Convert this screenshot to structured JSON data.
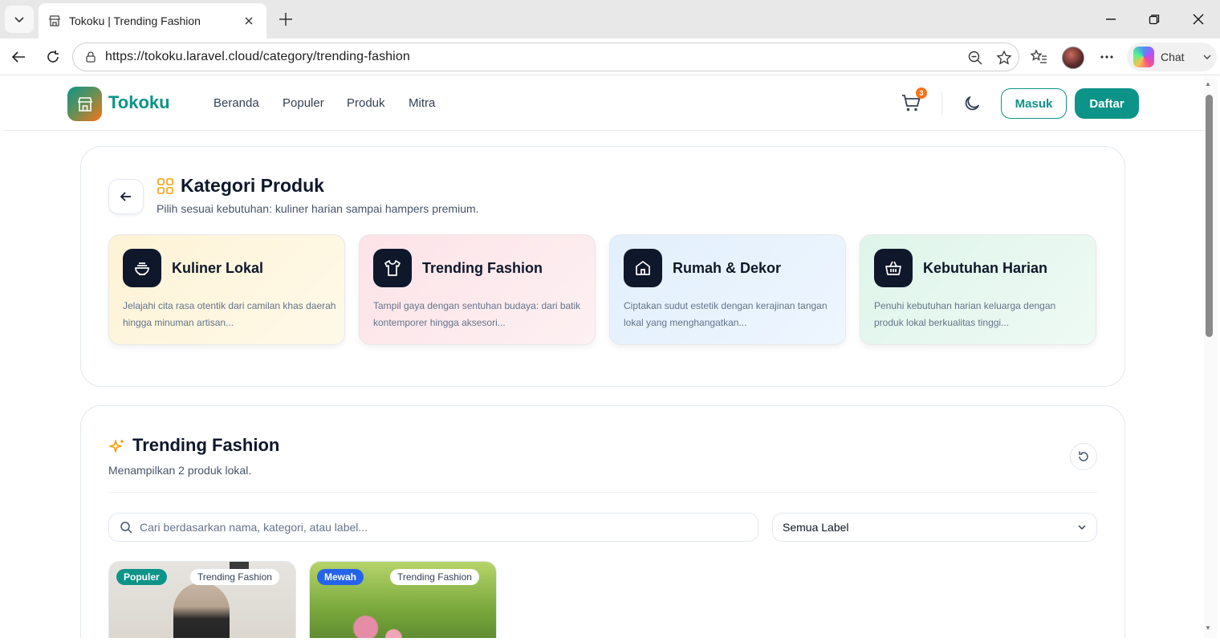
{
  "browser": {
    "tab_title": "Tokoku | Trending Fashion",
    "url": "https://tokoku.laravel.cloud/category/trending-fashion",
    "chat_label": "Chat"
  },
  "nav": {
    "brand": "Tokoku",
    "links": [
      "Beranda",
      "Populer",
      "Produk",
      "Mitra"
    ],
    "cart_count": "3",
    "login_label": "Masuk",
    "register_label": "Daftar"
  },
  "categories": {
    "title": "Kategori Produk",
    "subtitle": "Pilih sesuai kebutuhan: kuliner harian sampai hampers premium.",
    "items": [
      {
        "title": "Kuliner Lokal",
        "desc": "Jelajahi cita rasa otentik dari camilan khas daerah hingga minuman artisan...",
        "icon": "bowl-icon",
        "bg": "#fef6dc"
      },
      {
        "title": "Trending Fashion",
        "desc": "Tampil gaya dengan sentuhan budaya: dari batik kontemporer hingga aksesori...",
        "icon": "shirt-icon",
        "bg": "#fde8ec"
      },
      {
        "title": "Rumah & Dekor",
        "desc": "Ciptakan sudut estetik dengan kerajinan tangan lokal yang menghangatkan...",
        "icon": "home-icon",
        "bg": "#e6f2fd"
      },
      {
        "title": "Kebutuhan Harian",
        "desc": "Penuhi kebutuhan harian keluarga dengan produk lokal berkualitas tinggi...",
        "icon": "basket-icon",
        "bg": "#e3f7ee"
      }
    ]
  },
  "trending": {
    "title": "Trending Fashion",
    "subtitle": "Menampilkan 2 produk lokal.",
    "search_placeholder": "Cari berdasarkan nama, kategori, atau label...",
    "label_select": "Semua Label",
    "products": [
      {
        "badge": "Populer",
        "category": "Trending Fashion"
      },
      {
        "badge": "Mewah",
        "category": "Trending Fashion"
      }
    ]
  },
  "colors": {
    "accent": "#0d9488",
    "orange": "#f97316",
    "dark": "#0f172a"
  }
}
